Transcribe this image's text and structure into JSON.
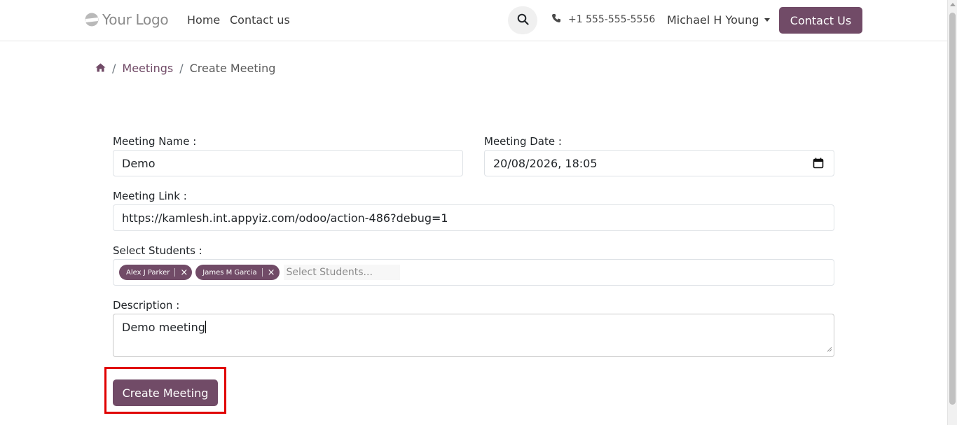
{
  "header": {
    "logo_text": "Your Logo",
    "nav": [
      {
        "label": "Home"
      },
      {
        "label": "Contact us"
      }
    ],
    "phone": "+1 555-555-5556",
    "user_name": "Michael H Young",
    "contact_button": "Contact Us"
  },
  "breadcrumb": {
    "items": [
      "Meetings",
      "Create Meeting"
    ],
    "separator": "/"
  },
  "form": {
    "meeting_name": {
      "label": "Meeting Name :",
      "value": "Demo"
    },
    "meeting_date": {
      "label": "Meeting Date :",
      "value": "20/08/2026, 18:05"
    },
    "meeting_link": {
      "label": "Meeting Link :",
      "value": "https://kamlesh.int.appyiz.com/odoo/action-486?debug=1"
    },
    "students": {
      "label": "Select Students :",
      "selected": [
        "Alex J Parker",
        "James M Garcia"
      ],
      "placeholder": "Select Students..."
    },
    "description": {
      "label": "Description :",
      "value": "Demo meeting"
    },
    "submit_label": "Create Meeting"
  },
  "colors": {
    "brand": "#714b67",
    "highlight": "#e00000"
  },
  "icons": {
    "logo": "logo-icon",
    "search": "search-icon",
    "phone": "phone-icon",
    "home": "home-icon",
    "calendar": "calendar-icon",
    "caret": "caret-down-icon",
    "remove": "close-icon"
  }
}
